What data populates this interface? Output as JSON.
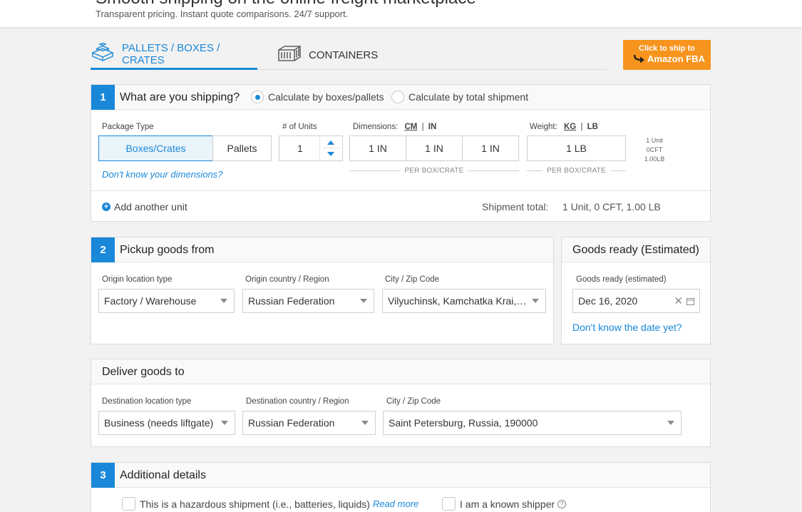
{
  "header": {
    "headline": "Smooth shipping on the online freight marketplace",
    "subheadline": "Transparent pricing. Instant quote comparisons. 24/7 support."
  },
  "tabs": [
    {
      "label": "PALLETS / BOXES / CRATES",
      "icon": "boxes-icon",
      "active": true
    },
    {
      "label": "CONTAINERS",
      "icon": "container-icon",
      "active": false
    }
  ],
  "amazon_button": {
    "line1": "Click to ship to",
    "line2": "Amazon FBA"
  },
  "colors": {
    "accent": "#1a88d9",
    "amazon": "#f7941d"
  },
  "section1": {
    "number": "1",
    "title": "What are you shipping?",
    "options": [
      {
        "label": "Calculate by boxes/pallets",
        "selected": true
      },
      {
        "label": "Calculate by total shipment",
        "selected": false
      }
    ],
    "package_type": {
      "label": "Package Type",
      "options": [
        "Boxes/Crates",
        "Pallets"
      ],
      "selected": "Boxes/Crates",
      "help_link": "Don't know your dimensions?"
    },
    "units": {
      "label": "# of Units",
      "value": "1"
    },
    "dimensions": {
      "label": "Dimensions:",
      "unit_cm": "CM",
      "separator": "|",
      "unit_in": "IN",
      "values": [
        "1 IN",
        "1 IN",
        "1 IN"
      ],
      "note": "PER BOX/CRATE"
    },
    "weight": {
      "label": "Weight:",
      "unit_kg": "KG",
      "separator": "|",
      "unit_lb": "LB",
      "value": "1 LB",
      "note": "PER BOX/CRATE"
    },
    "summary": {
      "unit": "1 Unit",
      "cft": "0CFT",
      "lb": "1.00LB"
    },
    "add_unit": "Add another unit",
    "total_label": "Shipment total:",
    "total_value": "1 Unit, 0 CFT, 1.00 LB"
  },
  "section2": {
    "number": "2",
    "title": "Pickup goods from",
    "origin_type": {
      "label": "Origin location type",
      "value": "Factory / Warehouse"
    },
    "origin_country": {
      "label": "Origin country / Region",
      "value": "Russian Federation"
    },
    "origin_city": {
      "label": "City / Zip Code",
      "value": "Vilyuchinsk, Kamchatka Krai, R..."
    }
  },
  "goods_ready": {
    "title": "Goods ready (Estimated)",
    "label": "Goods ready (estimated)",
    "value": "Dec 16, 2020",
    "link": "Don't know the date yet?"
  },
  "deliver": {
    "title": "Deliver goods to",
    "dest_type": {
      "label": "Destination location type",
      "value": "Business (needs liftgate)"
    },
    "dest_country": {
      "label": "Destination country / Region",
      "value": "Russian Federation"
    },
    "dest_city": {
      "label": "City / Zip Code",
      "value": "Saint Petersburg, Russia, 190000"
    }
  },
  "section3": {
    "number": "3",
    "title": "Additional details",
    "hazardous": {
      "label": "This is a hazardous shipment (i.e., batteries, liquids)",
      "link": "Read more"
    },
    "known_shipper": {
      "label": "I am a known shipper"
    }
  }
}
